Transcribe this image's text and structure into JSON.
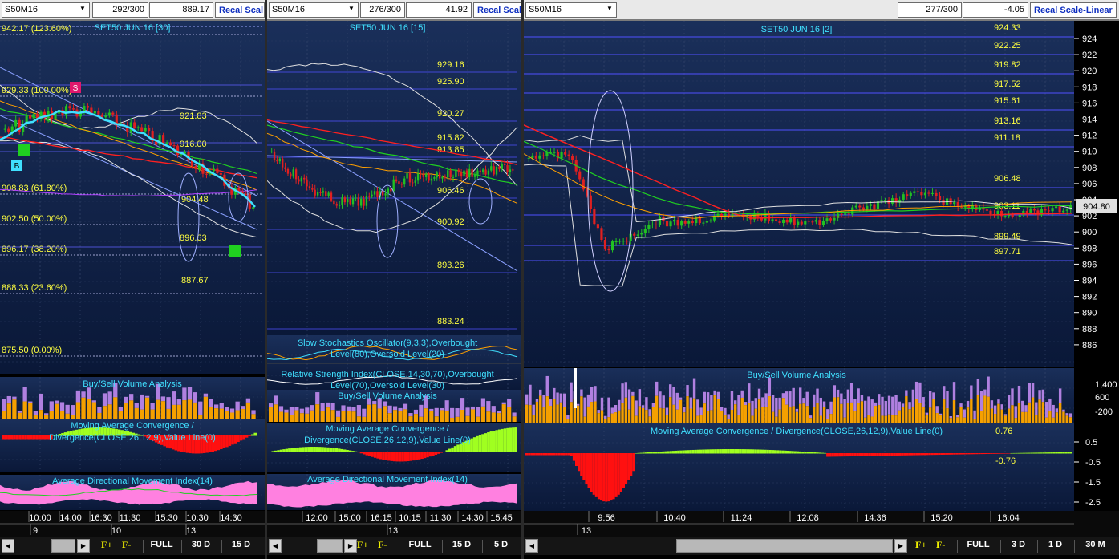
{
  "colors": {
    "background": "#000000",
    "gradient_top": "#1a2f5a",
    "gradient_bottom": "#0a1838",
    "hline": "#3030ff",
    "fib_line": "#ffffff",
    "candle_up": "#22c022",
    "candle_down": "#e02020",
    "vol_buy": "#f5a000",
    "vol_sell": "#b080e0",
    "macd_pos": "#a0ff20",
    "macd_neg": "#ff1010",
    "adx_fill": "#ff80e0",
    "label_cyan": "#40e0ff",
    "label_yellow": "#ffff40"
  },
  "panels": [
    {
      "symbol": "S50M16",
      "counter": "292/300",
      "value": "889.17",
      "recal_label": "Recal Scal",
      "main_title": "SET50 JUN 16  [30]",
      "fib_labels": [
        "942.17 (123.60%)",
        "929.33 (100.00%)",
        "908.83 (61.80%)",
        "902.50 (50.00%)",
        "896.17 (38.20%)",
        "888.33 (23.60%)",
        "875.50 (0.00%)"
      ],
      "price_labels": [
        "921.83",
        "916.00",
        "904.48",
        "896.63",
        "887.67"
      ],
      "signals": [
        {
          "label": "S",
          "color": "#e0186c"
        },
        {
          "label": "B",
          "color": "#40e0ff"
        }
      ],
      "volume_title": "Buy/Sell Volume Analysis",
      "macd_title_1": "Moving Average Convergence /",
      "macd_title_2": "Divergence(CLOSE,26,12,9),Value Line(0)",
      "adx_title": "Average Directional Movement Index(14)",
      "time_labels": [
        "10:00",
        "14:00",
        "16:30",
        "11:30",
        "15:30",
        "10:30",
        "14:30"
      ],
      "date_labels": [
        "9",
        "10",
        "13"
      ],
      "toolbar": [
        "FULL",
        "30 D",
        "15 D"
      ]
    },
    {
      "symbol": "S50M16",
      "counter": "276/300",
      "value": "41.92",
      "recal_label": "Recal Scal",
      "main_title": "SET50 JUN 16  [15]",
      "price_labels": [
        "929.16",
        "925.90",
        "920.27",
        "915.82",
        "913.85",
        "906.46",
        "900.92",
        "893.26",
        "883.24"
      ],
      "stoch_title_1": "Slow Stochastics Oscillator(9,3,3),Overbought",
      "stoch_title_2": "Level(80),Oversold Level(20)",
      "rsi_title_1": "Relative Strength Index(CLOSE,14,30,70),Overbought",
      "rsi_title_2": "Level(70),Oversold Level(30)",
      "volume_title": "Buy/Sell Volume Analysis",
      "macd_title_1": "Moving Average Convergence /",
      "macd_title_2": "Divergence(CLOSE,26,12,9),Value Line(0)",
      "adx_title": "Average Directional Movement Index(14)",
      "time_labels": [
        "12:00",
        "15:00",
        "16:15",
        "10:15",
        "11:30",
        "14:30",
        "15:45"
      ],
      "date_labels": [
        "13"
      ],
      "toolbar": [
        "FULL",
        "15 D",
        "5 D"
      ]
    },
    {
      "symbol": "S50M16",
      "counter": "277/300",
      "value": "-4.05",
      "recal_label": "Recal Scale-Linear",
      "main_title": "SET50 JUN 16  [2]",
      "price_labels": [
        "924.33",
        "922.25",
        "919.82",
        "917.52",
        "915.61",
        "913.16",
        "911.18",
        "906.48",
        "903.11",
        "899.49",
        "897.71"
      ],
      "axis_ticks": [
        "924",
        "922",
        "920",
        "918",
        "916",
        "914",
        "912",
        "910",
        "908",
        "906",
        "904",
        "902",
        "900",
        "898",
        "896",
        "894",
        "892",
        "890",
        "888",
        "886"
      ],
      "last_price": "904.80",
      "volume_title": "Buy/Sell Volume Analysis",
      "volume_ticks": [
        "1,400",
        "600",
        "-200"
      ],
      "macd_title": "Moving Average Convergence / Divergence(CLOSE,26,12,9),Value Line(0)",
      "macd_value": "0.76",
      "macd_value_neg": "-0.76",
      "macd_ticks": [
        "0.5",
        "-0.5",
        "-1.5",
        "-2.5"
      ],
      "time_labels": [
        "9:56",
        "10:40",
        "11:24",
        "12:08",
        "14:36",
        "15:20",
        "16:04"
      ],
      "date_labels": [
        "13"
      ],
      "toolbar": [
        "FULL",
        "3 D",
        "1 D",
        "30 M"
      ]
    }
  ]
}
